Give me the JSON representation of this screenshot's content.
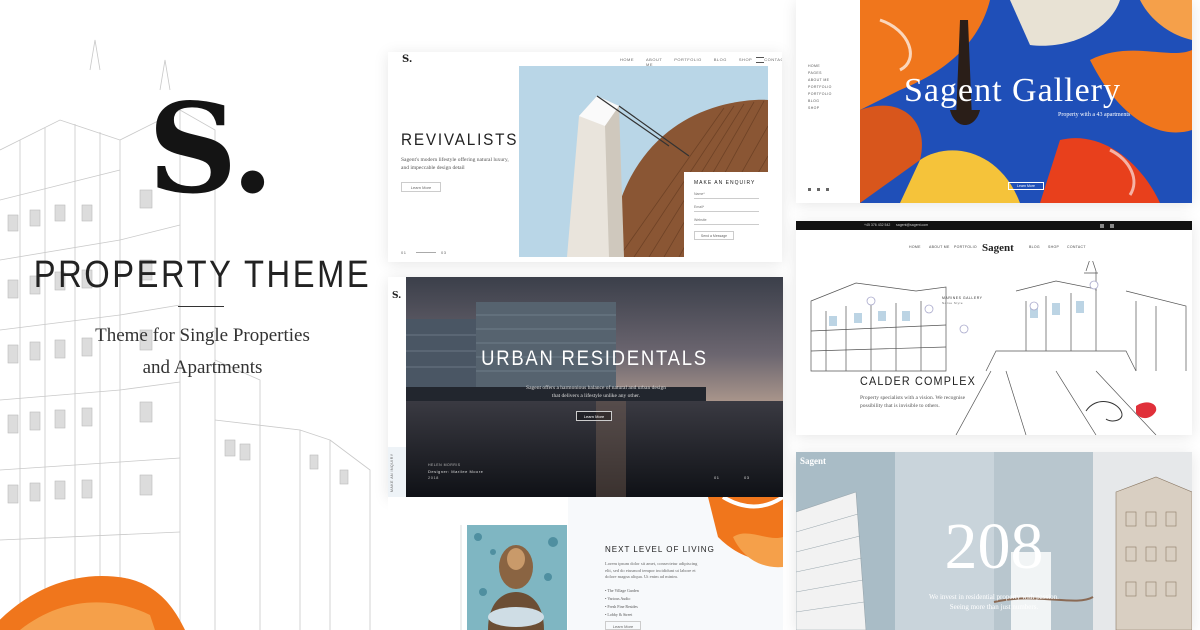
{
  "hero": {
    "logo": "S.",
    "title": "PROPERTY THEME",
    "subtitle_line1": "Theme for Single Properties",
    "subtitle_line2": "and Apartments"
  },
  "cards": {
    "revivalists": {
      "logo": "S.",
      "nav": [
        "HOME",
        "ABOUT ME",
        "PORTFOLIO",
        "BLOG",
        "SHOP",
        "CONTACT"
      ],
      "title": "REVIVALISTS",
      "text": "Sagent's modern lifestyle offering natural luxury, and impeccable design detail",
      "button": "Learn More",
      "pager": "01",
      "pager_end": "03",
      "form_title": "MAKE AN ENQUIRY",
      "form_fields": [
        "Name*",
        "Email*",
        "Website"
      ],
      "form_button": "Send a Message"
    },
    "urban": {
      "logo": "S.",
      "title": "URBAN RESIDENTALS",
      "text": "Sagent offers a harmonious balance of natural and urban design that delivers a lifestyle unlike any other.",
      "button": "Learn More",
      "side_label": "MAKE AN INQUIRY",
      "caption_small": "HELEN MORRIS",
      "caption": "Designer: Marilee Moore",
      "caption_year": "2018",
      "pager": "01",
      "pager_end": "03"
    },
    "next_level": {
      "title": "NEXT LEVEL OF LIVING",
      "text": "Lorem ipsum dolor sit amet, consectetur adipiscing elit, sed do eiusmod tempor incididunt ut labore et dolore magna aliqua. Ut enim ad minim.",
      "list": [
        "The Village Garden",
        "Various Audio",
        "Fresh Fine Resides",
        "Lobby & Street"
      ],
      "button": "Learn More"
    },
    "gallery": {
      "menu": [
        "HOME",
        "PAGES",
        "ABOUT ME",
        "PORTFOLIO",
        "PORTFOLIO",
        "BLOG",
        "SHOP"
      ],
      "title": "Sagent Gallery",
      "subtitle": "Property with a 43 apartments",
      "button": "Learn More"
    },
    "calder": {
      "topbar_phone": "+45 376 432 542",
      "topbar_email": "sagent@sagent.com",
      "nav": [
        "HOME",
        "ABOUT ME",
        "PORTFOLIO",
        "BLOG",
        "SHOP",
        "CONTACT"
      ],
      "brand": "Sagent",
      "pin_label": "MARINES GALLERY",
      "pin_sub": "Norse Style",
      "title": "CALDER COMPLEX",
      "text": "Property specialists with a vision. We recognise possibility that is invisible to others."
    },
    "two_oh_eight": {
      "brand": "Sagent",
      "number": "208",
      "text_line1": "We invest in residential property with passion.",
      "text_line2": "Seeing more than just numbers."
    }
  },
  "colors": {
    "accent_orange": "#f0761c",
    "sky": "#b9d6e7",
    "dark": "#141414"
  }
}
